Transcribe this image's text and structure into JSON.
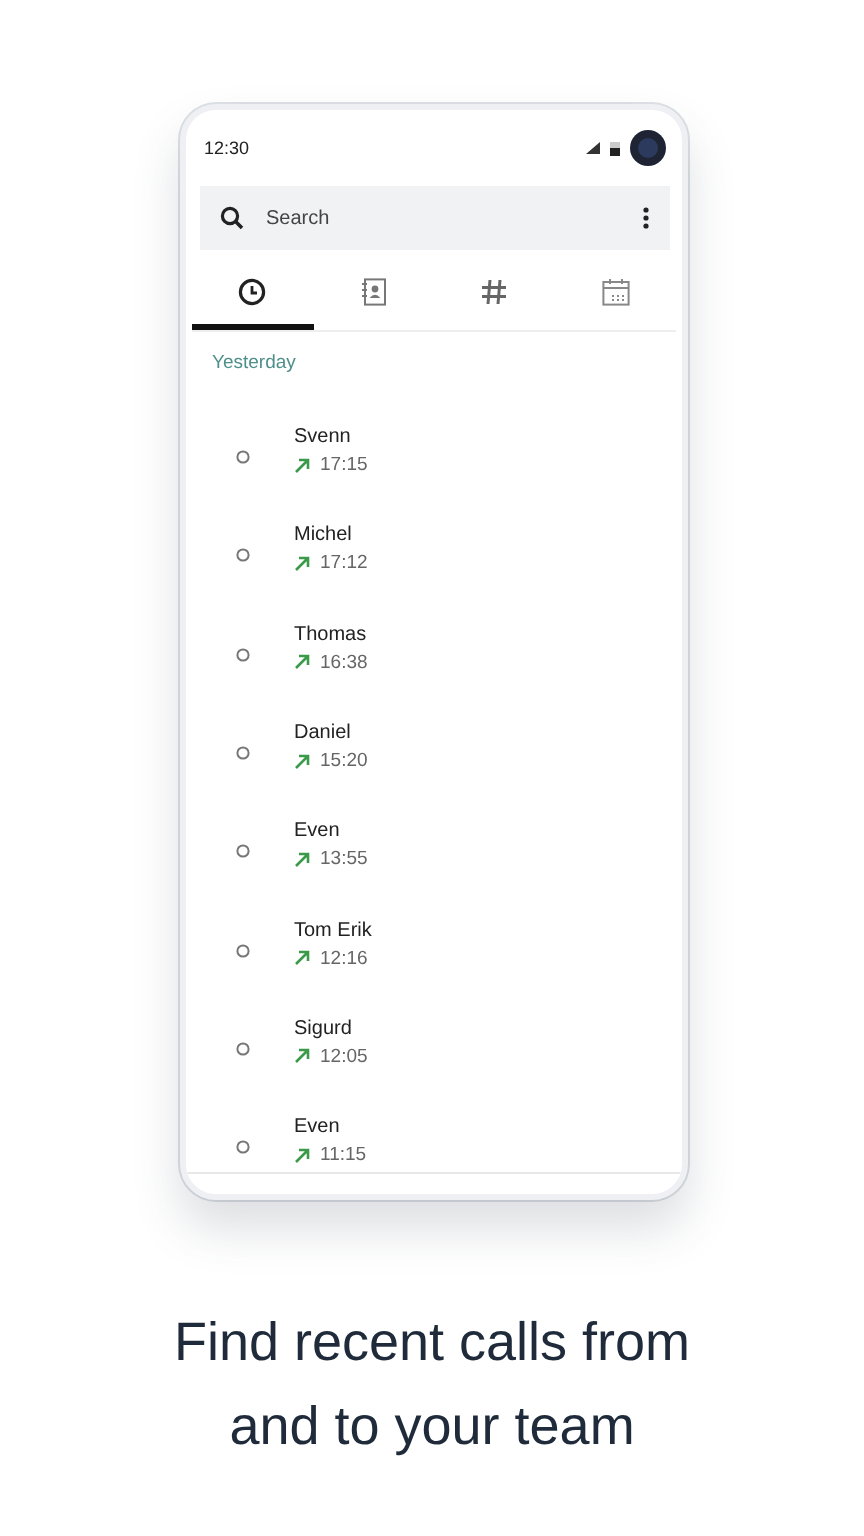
{
  "status_bar": {
    "time": "12:30"
  },
  "search": {
    "placeholder": "Search"
  },
  "tabs": [
    {
      "kind": "recent",
      "selected": true
    },
    {
      "kind": "contacts",
      "selected": false
    },
    {
      "kind": "dialpad",
      "selected": false
    },
    {
      "kind": "calendar",
      "selected": false
    }
  ],
  "section_label": "Yesterday",
  "calls": [
    {
      "name": "Svenn",
      "time": "17:15",
      "kind": "outgoing"
    },
    {
      "name": "Michel",
      "time": "17:12",
      "kind": "outgoing"
    },
    {
      "name": "Thomas",
      "time": "16:38",
      "kind": "outgoing"
    },
    {
      "name": "Daniel",
      "time": "15:20",
      "kind": "outgoing"
    },
    {
      "name": "Even",
      "time": "13:55",
      "kind": "outgoing"
    },
    {
      "name": "Tom Erik",
      "time": "12:16",
      "kind": "outgoing"
    },
    {
      "name": "Sigurd",
      "time": "12:05",
      "kind": "outgoing"
    },
    {
      "name": "Even",
      "time": "11:15",
      "kind": "outgoing"
    }
  ],
  "caption": "Find recent calls from and to your team"
}
